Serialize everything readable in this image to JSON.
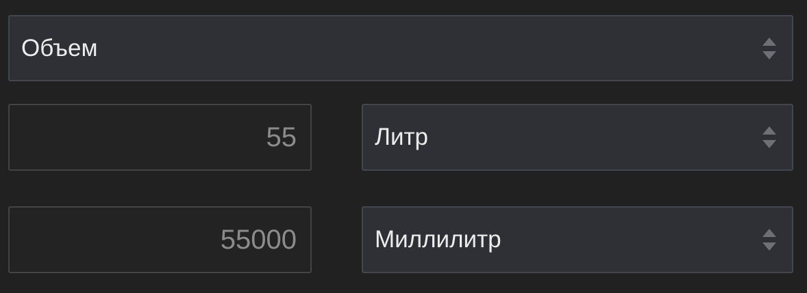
{
  "quantity": {
    "selected": "Объем"
  },
  "row1": {
    "value": "55",
    "unit": "Литр"
  },
  "row2": {
    "value": "55000",
    "unit": "Миллилитр"
  },
  "colors": {
    "background": "#212121",
    "select_bg": "#2e3035",
    "field_bg": "#232323",
    "text": "#ececec",
    "value_text": "#8c8c8c"
  },
  "icons": [
    "sort-arrows-icon"
  ]
}
